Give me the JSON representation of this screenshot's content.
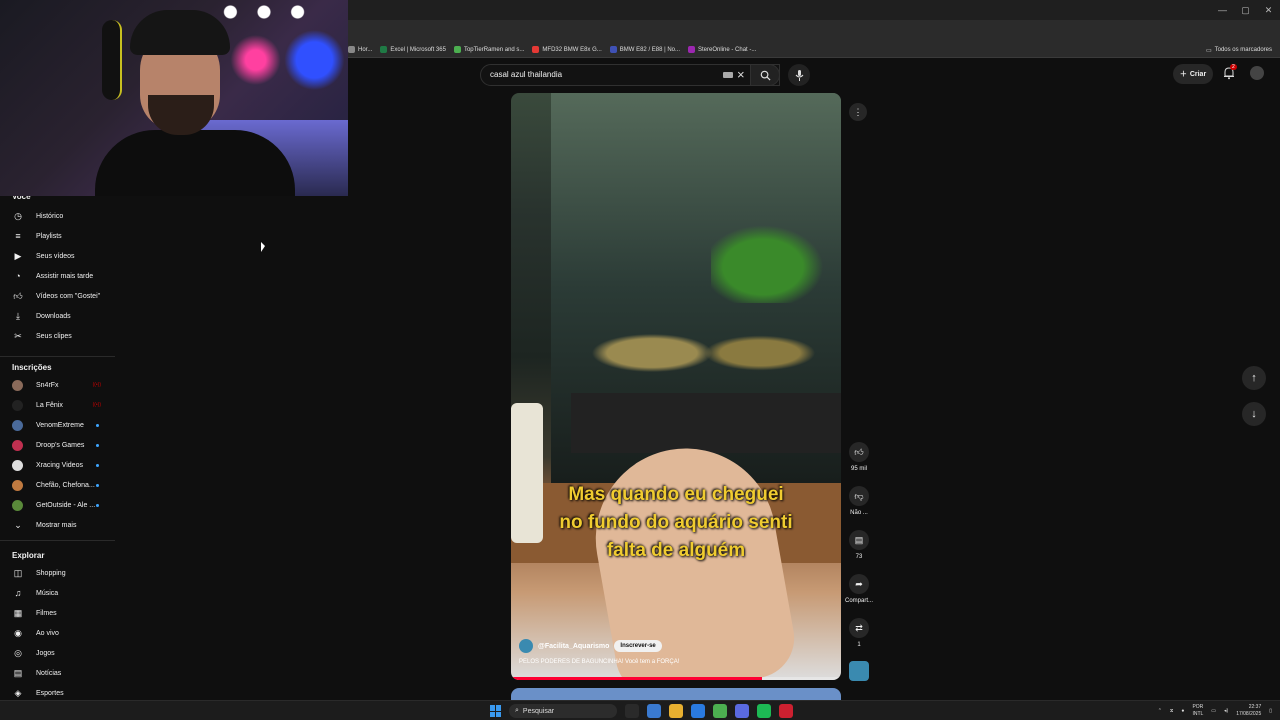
{
  "browser": {
    "bookmarks": [
      {
        "label": "Hor...",
        "color": "#888888"
      },
      {
        "label": "Excel | Microsoft 365",
        "color": "#1f7a45"
      },
      {
        "label": "TopTierRamen and s...",
        "color": "#4caf50"
      },
      {
        "label": "MFD32 BMW E8x G...",
        "color": "#e53935"
      },
      {
        "label": "BMW E82 / E88 | No...",
        "color": "#3f51b5"
      },
      {
        "label": "StereOnline - Chat -...",
        "color": "#9c27b0"
      }
    ],
    "all_bookmarks_label": "Todos os marcadores"
  },
  "header": {
    "search_query": "casal azul thailandia",
    "create_label": "Criar",
    "notification_count": "2"
  },
  "sidebar": {
    "you_heading": "Você",
    "you_items": [
      {
        "label": "Histórico",
        "icon": "history-icon"
      },
      {
        "label": "Playlists",
        "icon": "playlists-icon"
      },
      {
        "label": "Seus vídeos",
        "icon": "your-videos-icon"
      },
      {
        "label": "Assistir mais tarde",
        "icon": "watch-later-icon"
      },
      {
        "label": "Vídeos com \"Gostei\"",
        "icon": "liked-icon"
      },
      {
        "label": "Downloads",
        "icon": "download-icon"
      },
      {
        "label": "Seus clipes",
        "icon": "clips-icon"
      }
    ],
    "subs_heading": "Inscrições",
    "subscriptions": [
      {
        "label": "Sn4rFx",
        "color": "#8a6a5a",
        "status": "live"
      },
      {
        "label": "La Fênix",
        "color": "#222222",
        "status": "live"
      },
      {
        "label": "VenomExtreme",
        "color": "#4a6a9a",
        "status": "dot"
      },
      {
        "label": "Droop's Games",
        "color": "#c03050",
        "status": "dot"
      },
      {
        "label": "Xracing Videos",
        "color": "#dddddd",
        "status": "dot"
      },
      {
        "label": "Chefão, Chefona...",
        "color": "#c07a40",
        "status": "dot"
      },
      {
        "label": "GetOutside - Ale ...",
        "color": "#5a8a3a",
        "status": "dot"
      }
    ],
    "show_more_label": "Mostrar mais",
    "explore_heading": "Explorar",
    "explore_items": [
      {
        "label": "Shopping",
        "icon": "shopping-icon"
      },
      {
        "label": "Música",
        "icon": "music-icon"
      },
      {
        "label": "Filmes",
        "icon": "movies-icon"
      },
      {
        "label": "Ao vivo",
        "icon": "live-icon"
      },
      {
        "label": "Jogos",
        "icon": "gaming-icon"
      },
      {
        "label": "Notícias",
        "icon": "news-icon"
      },
      {
        "label": "Esportes",
        "icon": "sports-icon"
      }
    ]
  },
  "short": {
    "caption": "Mas quando eu cheguei\nno fundo do aquário senti\nfalta de alguém",
    "channel": "@Facilita_Aquarismo",
    "subscribe_label": "Inscrever-se",
    "title": "PELOS PODERES DE BAGUNCINHA! Você tem a FORÇA!",
    "progress": 0.76,
    "likes": "95 mil",
    "dislike_label": "Não ...",
    "comments": "73",
    "share_label": "Compart...",
    "remix_count": "1"
  },
  "taskbar": {
    "search_placeholder": "Pesquisar",
    "lang": "POR",
    "layout": "INTL",
    "time": "22:37",
    "date": "17/08/2025",
    "app_colors": [
      "#2a2a2a",
      "#3a7ad0",
      "#e8b030",
      "#2a7ae0",
      "#4caf50",
      "#5a6ae0",
      "#1db954",
      "#cc2030"
    ]
  },
  "colors": {
    "accent": "#ff0033",
    "caption": "#f0cc30"
  }
}
